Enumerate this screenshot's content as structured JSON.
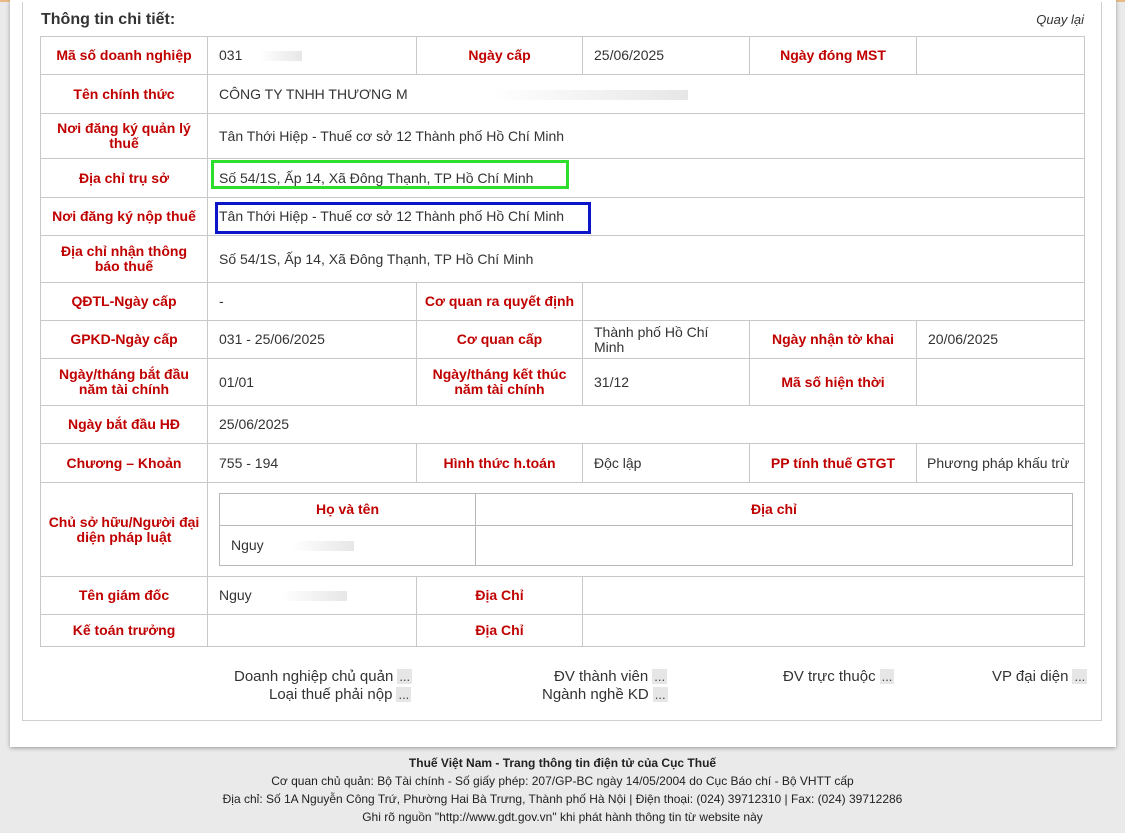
{
  "section_title": "Thông tin chi tiết:",
  "back_link": "Quay lại",
  "fields": {
    "tax_code_label": "Mã số doanh nghiệp",
    "tax_code_value": "031",
    "issue_date_label": "Ngày cấp",
    "issue_date_value": "25/06/2025",
    "close_date_label": "Ngày đóng MST",
    "close_date_value": "",
    "official_name_label": "Tên chính thức",
    "official_name_value": "CÔNG TY TNHH THƯƠNG M",
    "tax_mgmt_place_label": "Nơi đăng ký quản lý thuế",
    "tax_mgmt_place_value": "Tân Thới Hiệp - Thuế cơ sở 12 Thành phố Hồ Chí Minh",
    "head_office_label": "Địa chỉ trụ sở",
    "head_office_value": "Số 54/1S, Ấp 14, Xã Đông Thạnh, TP Hồ Chí Minh",
    "tax_payment_place_label": "Nơi đăng ký nộp thuế",
    "tax_payment_place_value": "Tân Thới Hiệp - Thuế cơ sở 12 Thành phố Hồ Chí Minh",
    "notice_address_label": "Địa chỉ nhận thông báo thuế",
    "notice_address_value": "Số 54/1S, Ấp 14, Xã Đông Thạnh, TP Hồ Chí Minh",
    "qdtl_label": "QĐTL-Ngày cấp",
    "qdtl_value": "-",
    "decision_agency_label": "Cơ quan ra quyết định",
    "decision_agency_value": "",
    "gpkd_label": "GPKD-Ngày cấp",
    "gpkd_value": "031 - 25/06/2025",
    "issuing_agency_label": "Cơ quan cấp",
    "issuing_agency_value": "Thành phố Hồ Chí Minh",
    "declaration_date_label": "Ngày nhận tờ khai",
    "declaration_date_value": "20/06/2025",
    "fy_start_label": "Ngày/tháng bắt đầu năm tài chính",
    "fy_start_value": "01/01",
    "fy_end_label": "Ngày/tháng kết thúc năm tài chính",
    "fy_end_value": "31/12",
    "current_code_label": "Mã số hiện thời",
    "current_code_value": "",
    "op_start_label": "Ngày bắt đầu HĐ",
    "op_start_value": "25/06/2025",
    "chapter_label": "Chương – Khoản",
    "chapter_value": "755 - 194",
    "accounting_label": "Hình thức h.toán",
    "accounting_value": "Độc lập",
    "vat_method_label": "PP tính thuế GTGT",
    "vat_method_value": "Phương pháp khấu trừ",
    "owner_label": "Chủ sở hữu/Người đại diện pháp luật",
    "owner_name_header": "Họ và tên",
    "owner_address_header": "Địa chỉ",
    "owner_name_value": "Nguy",
    "owner_address_value": "",
    "director_label": "Tên giám đốc",
    "director_value": "Nguy",
    "director_addr_label": "Địa Chỉ",
    "director_addr_value": "",
    "accountant_label": "Kế toán trưởng",
    "accountant_value": "",
    "accountant_addr_label": "Địa Chỉ",
    "accountant_addr_value": ""
  },
  "links": {
    "parent_company": "Doanh nghiệp chủ quản",
    "member_units": "ĐV thành viên",
    "affiliated_units": "ĐV trực thuộc",
    "rep_offices": "VP đại diện",
    "tax_types": "Loại thuế phải nộp",
    "business_lines": "Ngành nghề KD",
    "ellipsis": "..."
  },
  "footer": {
    "title": "Thuế Việt Nam - Trang thông tin điện tử của Cục Thuế",
    "line1": "Cơ quan chủ quản: Bộ Tài chính - Số giấy phép: 207/GP-BC ngày 14/05/2004 do Cục Báo chí - Bộ VHTT cấp",
    "line2": "Địa chỉ: Số 1A Nguyễn Công Trứ, Phường Hai Bà Trưng, Thành phố Hà Nội | Điện thoại: (024) 39712310 | Fax: (024) 39712286",
    "line3": "Ghi rõ nguồn \"http://www.gdt.gov.vn\" khi phát hành thông tin từ website này"
  },
  "colors": {
    "label_red": "#c00000",
    "highlight_green": "#2dde2d",
    "highlight_blue": "#0a16c8"
  }
}
